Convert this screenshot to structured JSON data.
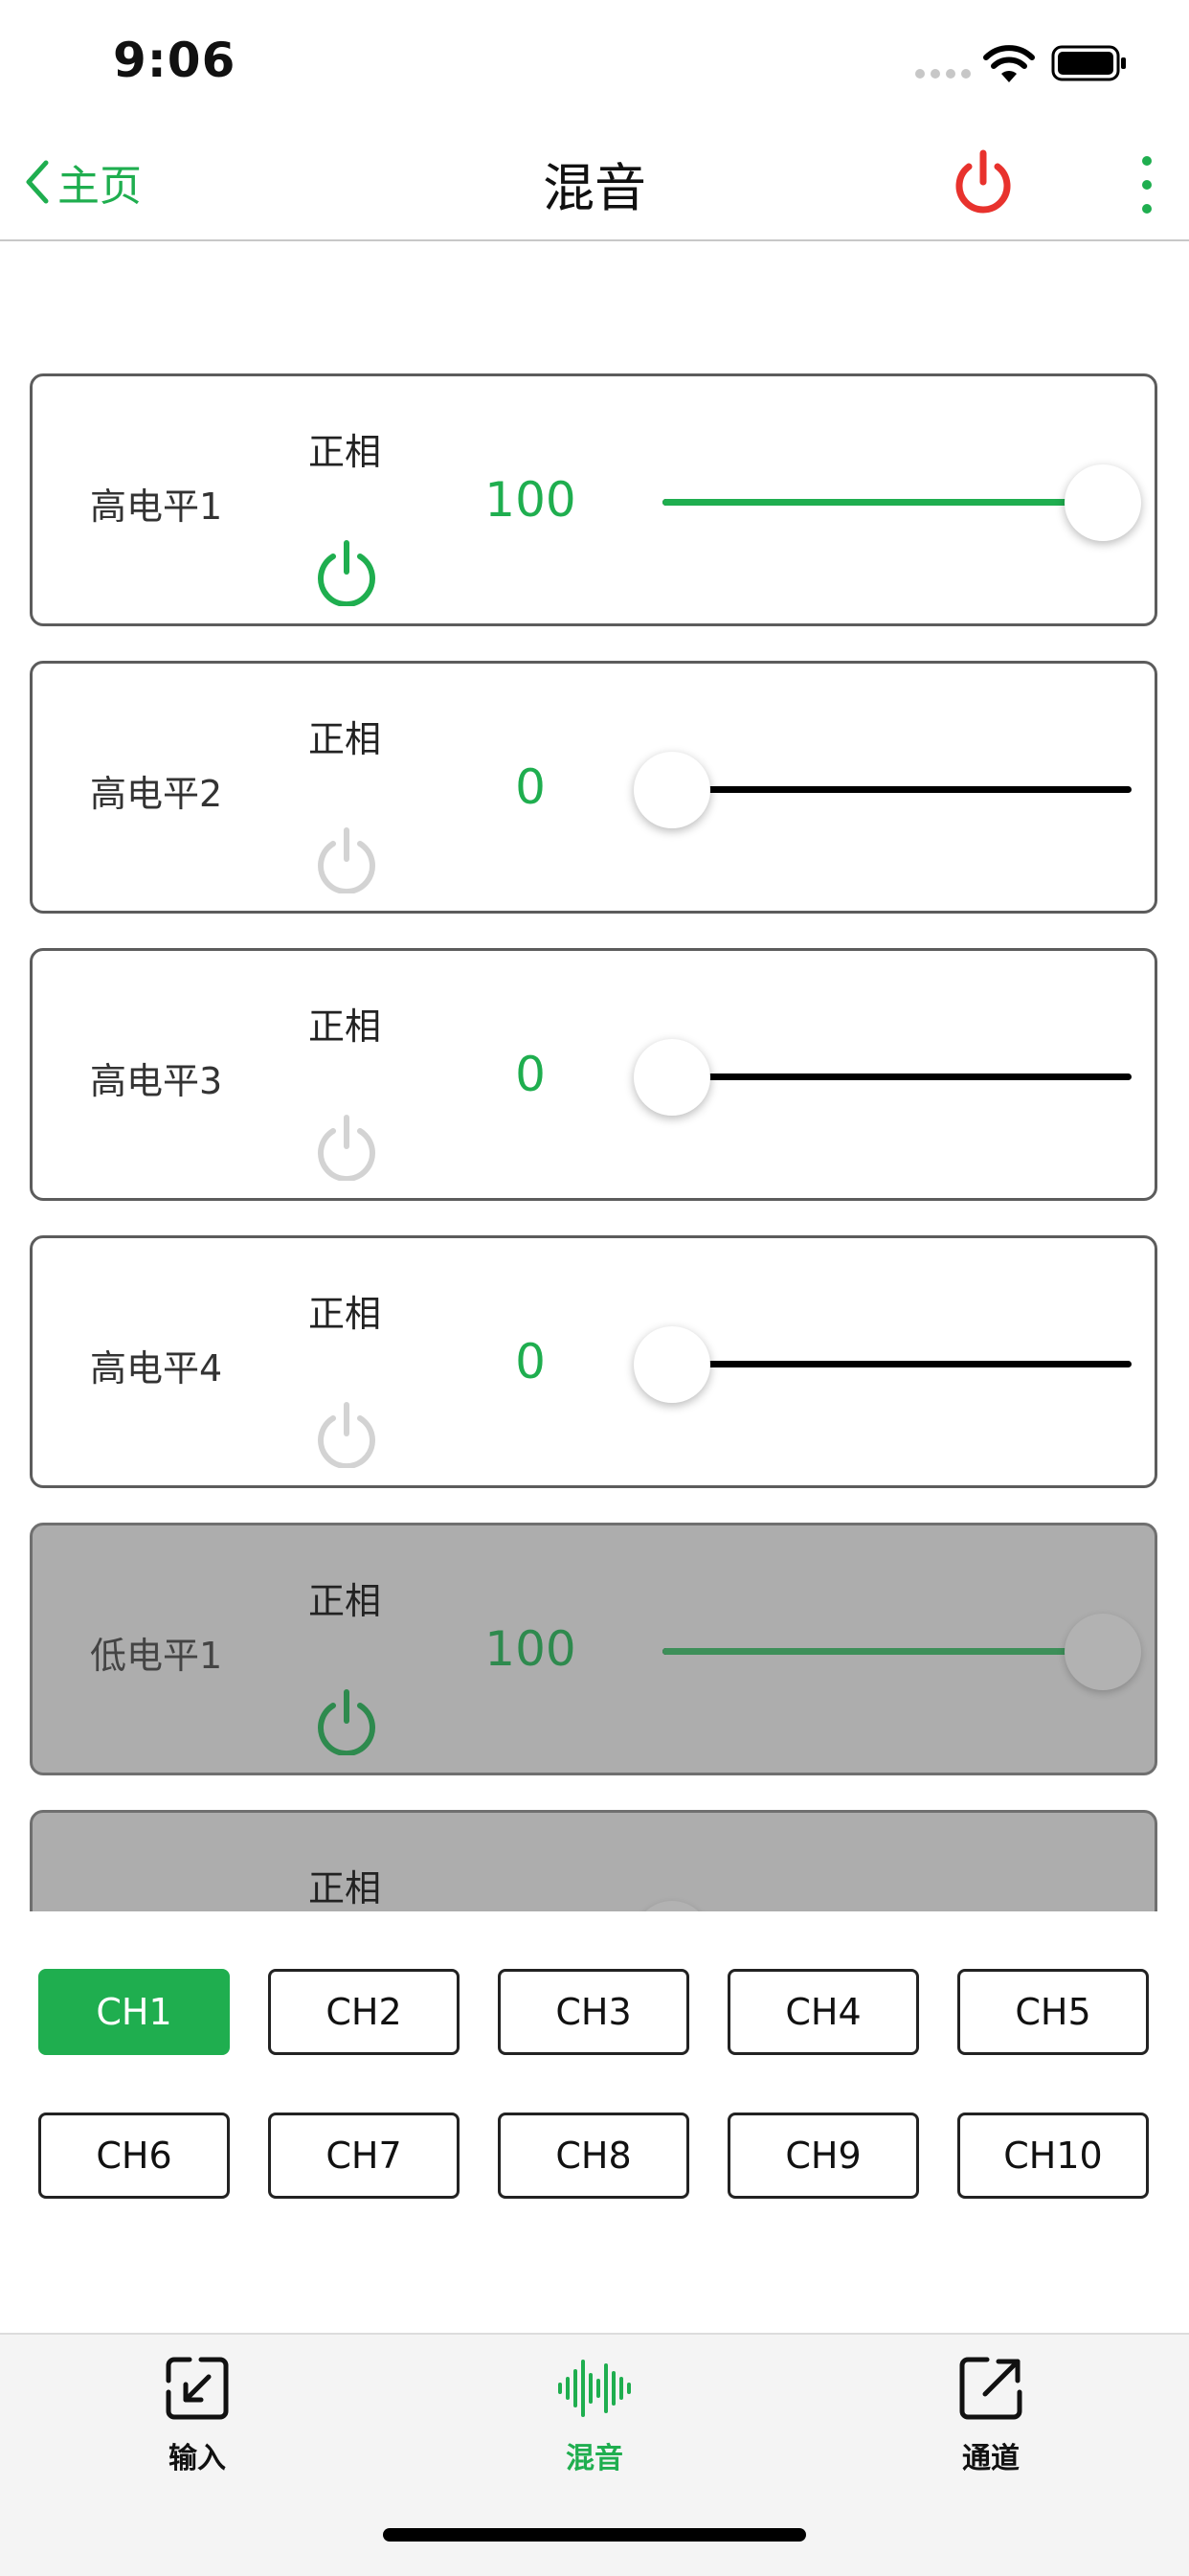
{
  "status": {
    "time": "9:06"
  },
  "nav": {
    "back_label": "主页",
    "title": "混音"
  },
  "colors": {
    "accent": "#1fae4f",
    "power_red": "#e8322d",
    "inactive_icon": "#d3d3d3"
  },
  "cards": [
    {
      "label": "高电平1",
      "phase": "正相",
      "value": "100",
      "level": 1.0,
      "enabled": true,
      "power_on": true
    },
    {
      "label": "高电平2",
      "phase": "正相",
      "value": "0",
      "level": 0.0,
      "enabled": true,
      "power_on": false
    },
    {
      "label": "高电平3",
      "phase": "正相",
      "value": "0",
      "level": 0.0,
      "enabled": true,
      "power_on": false
    },
    {
      "label": "高电平4",
      "phase": "正相",
      "value": "0",
      "level": 0.0,
      "enabled": true,
      "power_on": false
    },
    {
      "label": "低电平1",
      "phase": "正相",
      "value": "100",
      "level": 1.0,
      "enabled": false,
      "power_on": true
    },
    {
      "label": "",
      "phase": "正相",
      "value": "",
      "level": 0.0,
      "enabled": false,
      "power_on": false
    }
  ],
  "channels": {
    "items": [
      "CH1",
      "CH2",
      "CH3",
      "CH4",
      "CH5",
      "CH6",
      "CH7",
      "CH8",
      "CH9",
      "CH10"
    ],
    "selected": "CH1"
  },
  "tabs": [
    {
      "label": "输入",
      "icon": "arrow-down-left-box-icon",
      "active": false
    },
    {
      "label": "混音",
      "icon": "waveform-icon",
      "active": true
    },
    {
      "label": "通道",
      "icon": "arrow-up-right-box-icon",
      "active": false
    }
  ]
}
